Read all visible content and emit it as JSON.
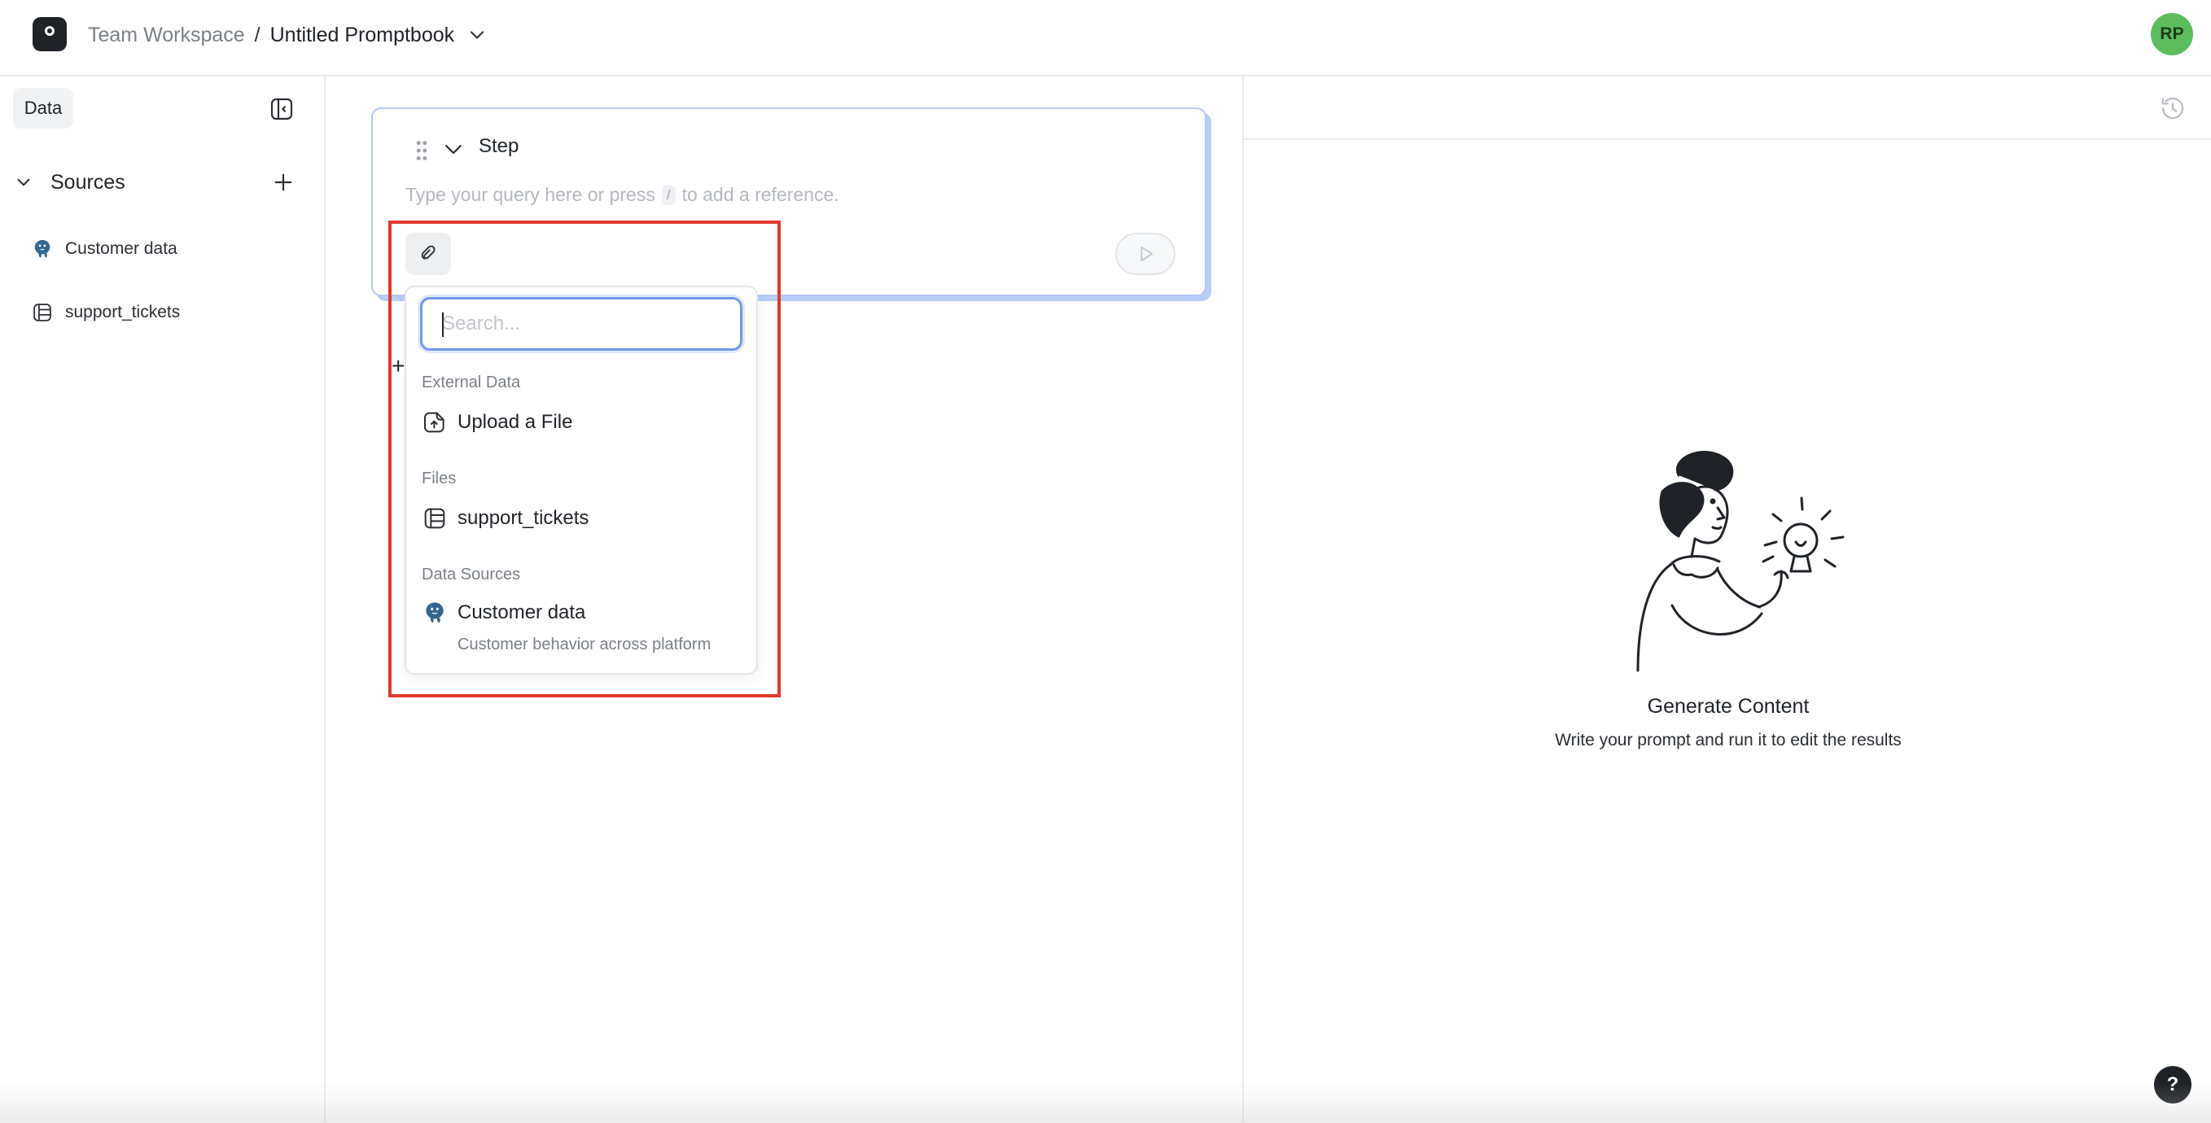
{
  "header": {
    "workspace": "Team Workspace",
    "separator": "/",
    "promptbook": "Untitled Promptbook",
    "avatar_initials": "RP"
  },
  "sidebar": {
    "tab_label": "Data",
    "sources_label": "Sources",
    "items": [
      {
        "label": "Customer data",
        "icon": "postgres-icon"
      },
      {
        "label": "support_tickets",
        "icon": "table-icon"
      }
    ]
  },
  "step": {
    "label": "Step",
    "placeholder_before": "Type your query here or press",
    "placeholder_key": "/",
    "placeholder_after": "to add a reference."
  },
  "dropdown": {
    "search_placeholder": "Search...",
    "groups": [
      {
        "label": "External Data",
        "items": [
          {
            "label": "Upload a File",
            "icon": "upload-file-icon"
          }
        ]
      },
      {
        "label": "Files",
        "items": [
          {
            "label": "support_tickets",
            "icon": "table-icon"
          }
        ]
      },
      {
        "label": "Data Sources",
        "items": [
          {
            "label": "Customer data",
            "subtitle": "Customer behavior across platform",
            "icon": "postgres-icon"
          }
        ]
      }
    ]
  },
  "results": {
    "title": "Generate Content",
    "subtitle": "Write your prompt and run it to edit the results"
  },
  "help_label": "?",
  "add_label": "+",
  "colors": {
    "accent_border": "#b6c9f5",
    "highlight": "#e1392c",
    "avatar": "#5cbd5c"
  }
}
